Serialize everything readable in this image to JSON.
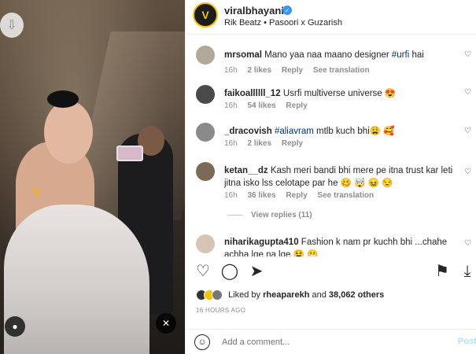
{
  "post": {
    "username": "viralbhayani",
    "audio": "Rik Beatz • Pasoori x Guzarish",
    "likes_by": "rheaparekh",
    "likes_rest": "38,062 others",
    "likes_prefix": "Liked by",
    "likes_and": "and",
    "time": "16 HOURS AGO"
  },
  "comments": [
    {
      "user": "mrsomal",
      "text_before": "Mano yaa naa maano designer ",
      "hashtag": "#urfi",
      "text_after": " hai",
      "time": "16h",
      "likes": "2 likes",
      "reply": "Reply",
      "translate": "See translation"
    },
    {
      "user": "faikoallllll_12",
      "text_before": "Usrfi multiverse universe 😍",
      "hashtag": "",
      "text_after": "",
      "time": "16h",
      "likes": "54 likes",
      "reply": "Reply",
      "translate": ""
    },
    {
      "user": "_dracovish",
      "text_before": "",
      "hashtag": "#aliavram",
      "text_after": " mtlb kuch bhi😩 🥰",
      "time": "16h",
      "likes": "2 likes",
      "reply": "Reply",
      "translate": ""
    },
    {
      "user": "ketan__dz",
      "text_before": "Kash meri bandi bhi mere pe itna trust kar leti jitna isko lss celotape par he 🥴 🤯 😖 😒",
      "hashtag": "",
      "text_after": "",
      "time": "16h",
      "likes": "36 likes",
      "reply": "Reply",
      "translate": "See translation"
    },
    {
      "user": "niharikagupta410",
      "text_before": "Fashion k nam pr kuchh bhi ...chahe achha lge na lge 😫 😬",
      "hashtag": "",
      "text_after": "",
      "time": "",
      "likes": "",
      "reply": "",
      "translate": ""
    }
  ],
  "view_replies": "View replies (11)",
  "add_comment": {
    "placeholder": "Add a comment...",
    "post_label": "Post"
  },
  "icons": {
    "heart": "heart-icon",
    "comment": "comment-icon",
    "share": "share-icon",
    "save": "bookmark-icon",
    "download": "download-icon",
    "emoji": "emoji-icon"
  },
  "colors": {
    "accent": "#3897f0",
    "link": "#00376b",
    "post_disabled": "#b2dffc",
    "brand_yellow": "#f6c400"
  }
}
